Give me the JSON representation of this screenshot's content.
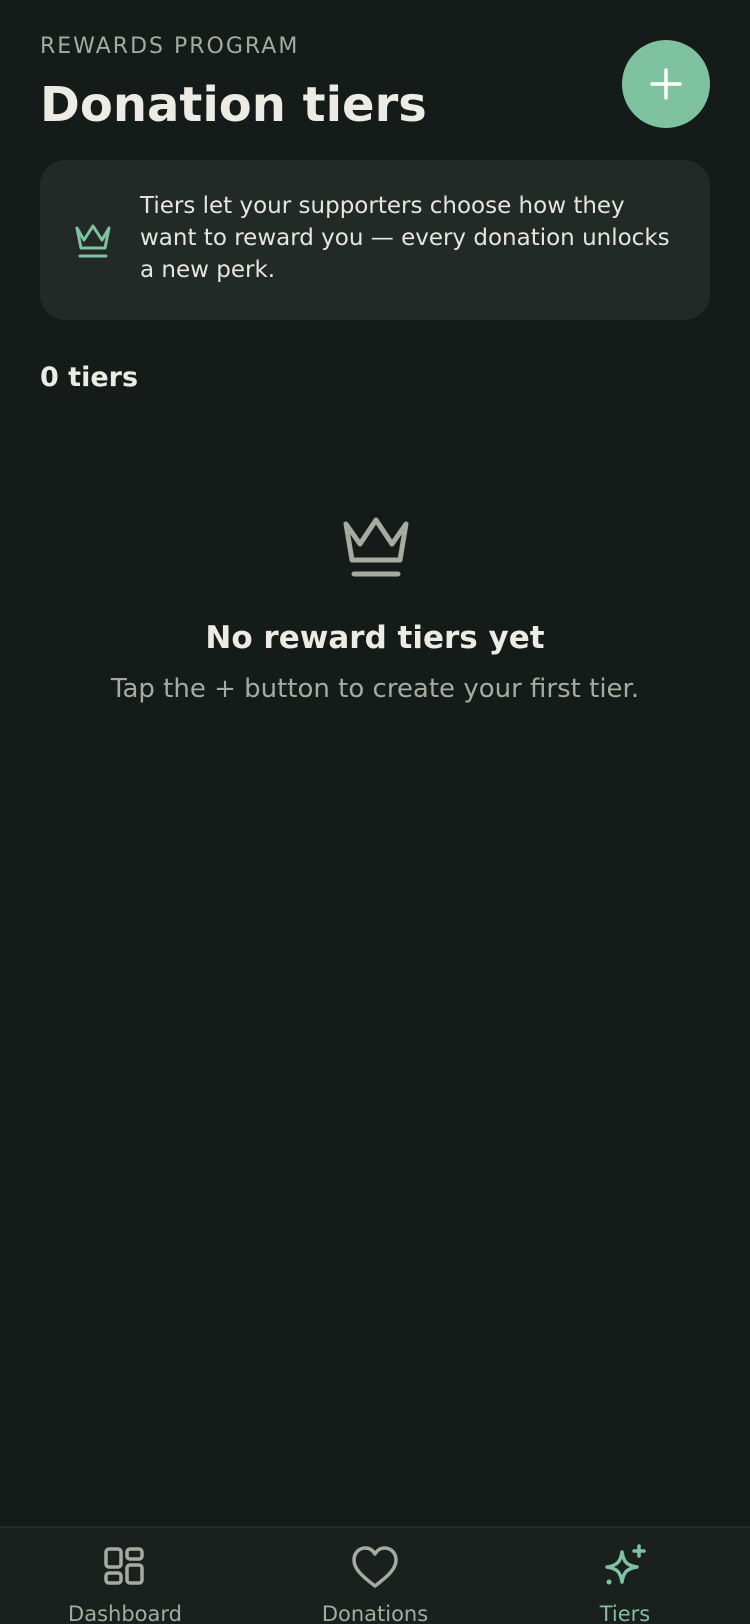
{
  "header": {
    "overline": "REWARDS PROGRAM",
    "title": "Donation tiers",
    "add_button_icon": "plus-icon"
  },
  "info_card": {
    "icon": "crown-icon",
    "text": "Tiers let your supporters choose how they want to reward you — every donation unlocks a new perk."
  },
  "tier_count": "0 tiers",
  "empty_state": {
    "icon": "crown-icon",
    "title": "No reward tiers yet",
    "subtitle": "Tap the + button to create your first tier."
  },
  "bottom_nav": {
    "items": [
      {
        "label": "Dashboard",
        "icon": "grid-icon",
        "active": false
      },
      {
        "label": "Donations",
        "icon": "heart-icon",
        "active": false
      },
      {
        "label": "Tiers",
        "icon": "sparkle-icon",
        "active": true
      }
    ]
  },
  "colors": {
    "background": "#151b18",
    "card": "#212a26",
    "accent": "#7fc29f",
    "text_primary": "#ecebe4",
    "text_secondary": "#a7ab9f"
  }
}
